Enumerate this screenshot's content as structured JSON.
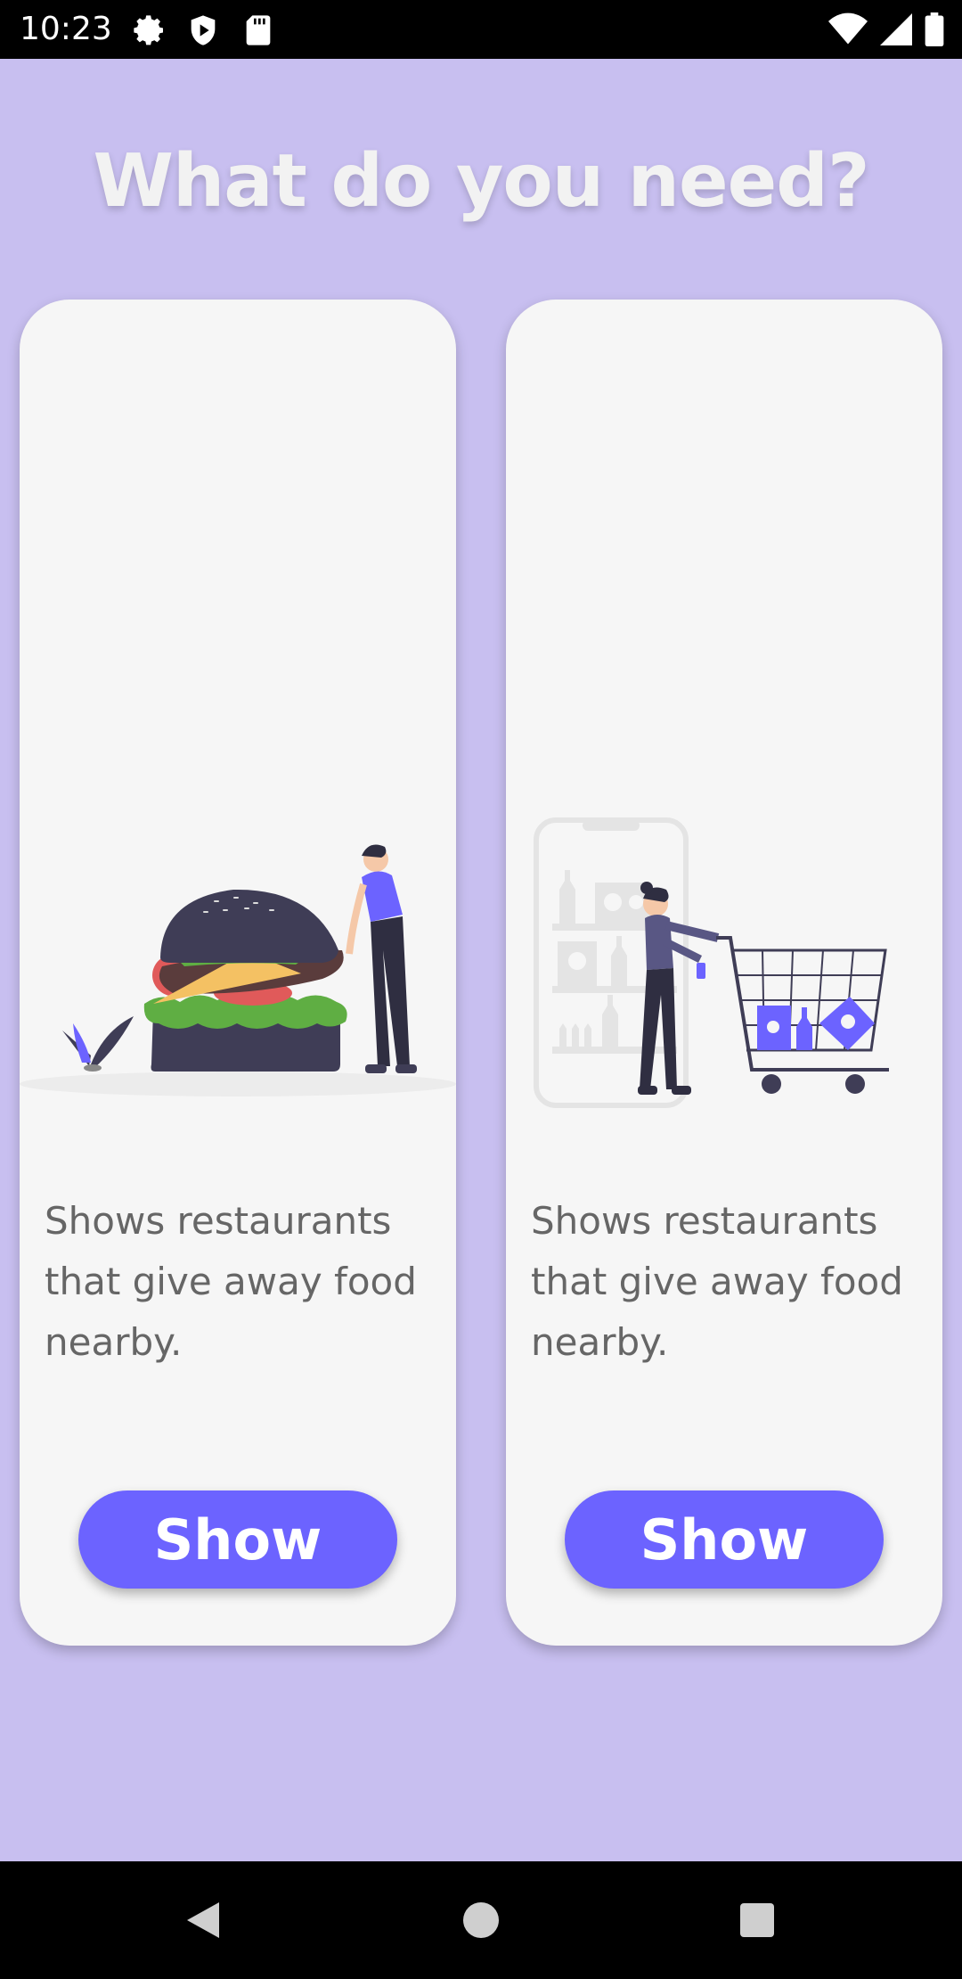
{
  "status_bar": {
    "time": "10:23",
    "icons_left": [
      "gear-icon",
      "shield-icon",
      "sd-card-icon"
    ],
    "icons_right": [
      "wifi-icon",
      "signal-icon",
      "battery-icon"
    ]
  },
  "header": {
    "title": "What do you need?"
  },
  "cards": [
    {
      "illustration": "burger-illustration",
      "description": "Shows restaurants that give away food nearby.",
      "button_label": "Show"
    },
    {
      "illustration": "shopping-cart-illustration",
      "description": "Shows restaurants that give away food nearby.",
      "button_label": "Show"
    }
  ],
  "colors": {
    "background": "#c8bff0",
    "card": "#f6f6f6",
    "accent": "#6c63ff",
    "title": "#f2f2f2"
  },
  "nav_bar": {
    "icons": [
      "back-icon",
      "home-icon",
      "recents-icon"
    ]
  }
}
